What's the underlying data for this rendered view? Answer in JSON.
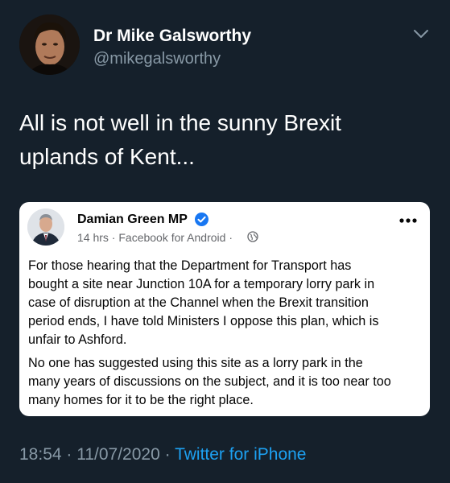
{
  "tweet": {
    "author": {
      "display_name": "Dr Mike Galsworthy",
      "handle": "@mikegalsworthy"
    },
    "text": "All is not well in the sunny Brexit\nuplands of Kent...",
    "timestamp": "18:54 · 11/07/2020",
    "separator": "·",
    "source": "Twitter for iPhone",
    "menu_icon": "chevron-down-icon"
  },
  "facebook_post": {
    "author": "Damian Green MP",
    "verified_icon": "verified-badge-icon",
    "meta": "14 hrs · Facebook for Android ·",
    "privacy_icon": "globe-icon",
    "more_icon": "more-options-icon",
    "paragraphs": [
      "For those hearing that the Department for Transport has\nbought a site near Junction 10A for a temporary lorry park in\ncase of disruption at the Channel when the Brexit transition\nperiod ends, I have told Ministers I oppose this plan, which is\nunfair to Ashford.",
      "No one has suggested using this site as a lorry park in the\nmany years of discussions on the subject, and it is too near too\nmany homes for it to be the right place."
    ]
  },
  "colors": {
    "background": "#15202b",
    "text_primary": "#ffffff",
    "text_secondary": "#8899a6",
    "link": "#1da1f2",
    "card_background": "#ffffff",
    "facebook_blue": "#1877f2"
  }
}
